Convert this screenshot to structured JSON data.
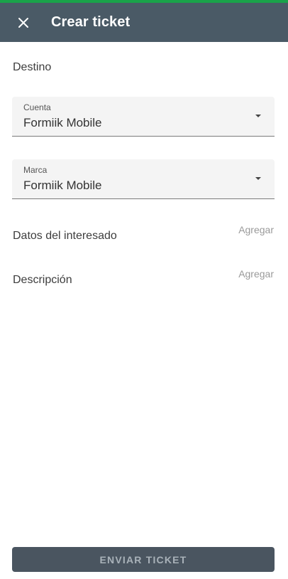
{
  "header": {
    "title": "Crear ticket",
    "close_icon": "close-icon"
  },
  "form": {
    "destino_label": "Destino",
    "cuenta": {
      "label": "Cuenta",
      "value": "Formiik Mobile"
    },
    "marca": {
      "label": "Marca",
      "value": "Formiik Mobile"
    },
    "interesado_label": "Datos del interesado",
    "interesado_action": "Agregar",
    "descripcion_label": "Descripción",
    "descripcion_action": "Agregar"
  },
  "footer": {
    "submit_label": "ENVIAR TICKET"
  },
  "colors": {
    "header_bg": "#4a5a66",
    "accent": "#1aa24a",
    "button_bg": "#4a5560"
  }
}
